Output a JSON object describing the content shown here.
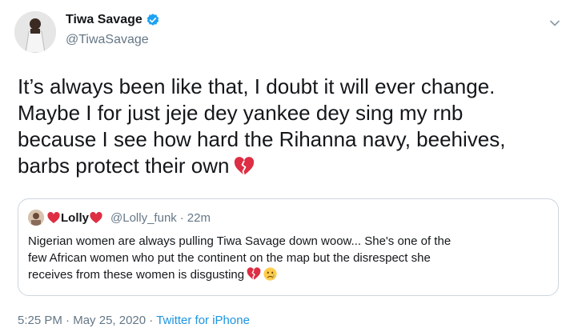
{
  "author": {
    "name": "Tiwa Savage",
    "handle": "@TiwaSavage",
    "verified": true
  },
  "tweet": {
    "lines": [
      "It’s always been like that, I doubt it will ever change.",
      "Maybe I for just jeje dey yankee dey sing my rnb",
      "because I see how hard the Rihanna navy, beehives,",
      "barbs protect their own"
    ],
    "emoji": "broken-heart-icon"
  },
  "quote": {
    "name": "Lolly",
    "handle": "@Lolly_funk",
    "separator": "·",
    "time": "22m",
    "lines": [
      "Nigerian women are always pulling Tiwa Savage down woow... She's one of the",
      "few African women who put the continent on the map but the disrespect she",
      "receives from these women is disgusting"
    ],
    "emojis": [
      "broken-heart-icon",
      "crying-face-icon"
    ]
  },
  "footer": {
    "time": "5:25 PM",
    "separator1": " · ",
    "date": "May 25, 2020",
    "separator2": " · ",
    "source": "Twitter for iPhone"
  },
  "colors": {
    "accent": "#1b95e0",
    "heart": "#e0245e",
    "muted": "#657786",
    "border": "#ccd6dd"
  }
}
